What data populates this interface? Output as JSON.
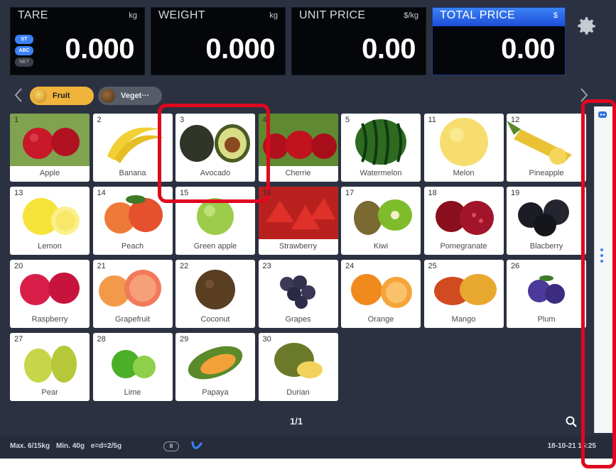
{
  "display": {
    "tare": {
      "label": "TARE",
      "unit": "kg",
      "value": "0.000"
    },
    "weight": {
      "label": "WEIGHT",
      "unit": "kg",
      "value": "0.000"
    },
    "unit_price": {
      "label": "UNIT PRICE",
      "unit": "$/kg",
      "value": "0.00"
    },
    "total_price": {
      "label": "TOTAL PRICE",
      "unit": "$",
      "value": "0.00"
    },
    "status_stack": [
      "ST",
      "ABC",
      "NET"
    ]
  },
  "categories": [
    {
      "label": "Fruit",
      "active": true
    },
    {
      "label": "Veget···",
      "active": false
    }
  ],
  "products": [
    {
      "num": "1",
      "name": "Apple"
    },
    {
      "num": "2",
      "name": "Banana"
    },
    {
      "num": "3",
      "name": "Avocado"
    },
    {
      "num": "4",
      "name": "Cherrie"
    },
    {
      "num": "5",
      "name": "Watermelon"
    },
    {
      "num": "11",
      "name": "Melon"
    },
    {
      "num": "12",
      "name": "Pineapple"
    },
    {
      "num": "13",
      "name": "Lemon"
    },
    {
      "num": "14",
      "name": "Peach"
    },
    {
      "num": "15",
      "name": "Green apple"
    },
    {
      "num": "16",
      "name": "Strawberry"
    },
    {
      "num": "17",
      "name": "Kiwi"
    },
    {
      "num": "18",
      "name": "Pomegranate"
    },
    {
      "num": "19",
      "name": "Blacberry"
    },
    {
      "num": "20",
      "name": "Raspberry"
    },
    {
      "num": "21",
      "name": "Grapefruit"
    },
    {
      "num": "22",
      "name": "Coconut"
    },
    {
      "num": "23",
      "name": "Grapes"
    },
    {
      "num": "24",
      "name": "Orange"
    },
    {
      "num": "25",
      "name": "Mango"
    },
    {
      "num": "26",
      "name": "Plum"
    },
    {
      "num": "27",
      "name": "Pear"
    },
    {
      "num": "28",
      "name": "Lime"
    },
    {
      "num": "29",
      "name": "Papaya"
    },
    {
      "num": "30",
      "name": "Durian"
    }
  ],
  "pagination": {
    "text": "1/1"
  },
  "status_bar": {
    "max": "Max. 6/15kg",
    "min": "Min. 40g",
    "division": "e=d=2/5g",
    "badge": "Ⅲ",
    "datetime": "18-10-21 15:25"
  },
  "colors": {
    "active_category": "#f0b43c",
    "total_price_header": "#2563eb",
    "highlight": "#e0081f"
  }
}
